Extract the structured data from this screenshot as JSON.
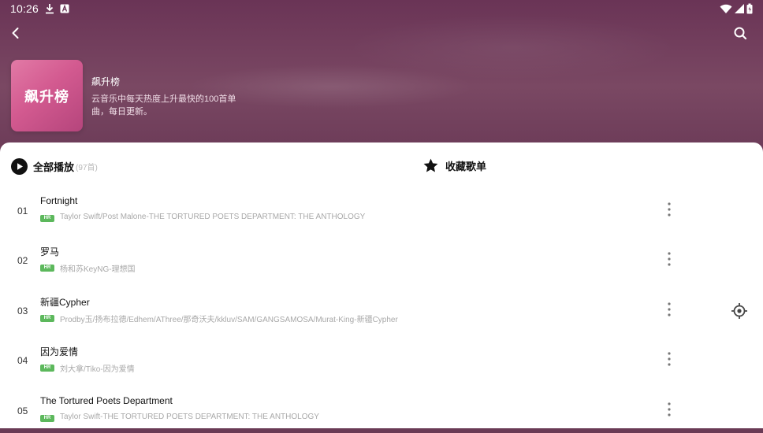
{
  "status_bar": {
    "time": "10:26"
  },
  "playlist": {
    "cover_text": "飙升榜",
    "title": "飙升榜",
    "description": "云音乐中每天热度上升最快的100首单曲，每日更新。"
  },
  "actions": {
    "play_all_label": "全部播放",
    "play_all_count": "(97首)",
    "favorite_label": "收藏歌单"
  },
  "songs": [
    {
      "index": "01",
      "title": "Fortnight",
      "badge": "HR",
      "artist": "Taylor Swift/Post Malone-THE TORTURED POETS DEPARTMENT: THE ANTHOLOGY"
    },
    {
      "index": "02",
      "title": "罗马",
      "badge": "HR",
      "artist": "杨和苏KeyNG-理想国"
    },
    {
      "index": "03",
      "title": "新疆Cypher",
      "badge": "HR",
      "artist": "Prodby玉/扬布拉德/Edhem/AThree/那奇沃夫/kkluv/SAM/GANGSAMOSA/Murat-King-新疆Cypher"
    },
    {
      "index": "04",
      "title": "因为爱情",
      "badge": "HR",
      "artist": "刘大拿/Tiko-因为爱情"
    },
    {
      "index": "05",
      "title": "The Tortured Poets Department",
      "badge": "HR",
      "artist": "Taylor Swift-THE TORTURED POETS DEPARTMENT: THE ANTHOLOGY"
    }
  ],
  "icons": {
    "back": "back-arrow-icon",
    "search": "search-icon",
    "play": "play-circle-icon",
    "favorite": "star-icon",
    "more": "more-vertical-icon",
    "locate": "locate-icon"
  },
  "colors": {
    "header": "#6f3c5b",
    "cover": "#d35a90",
    "hr_badge": "#5cb85c"
  }
}
